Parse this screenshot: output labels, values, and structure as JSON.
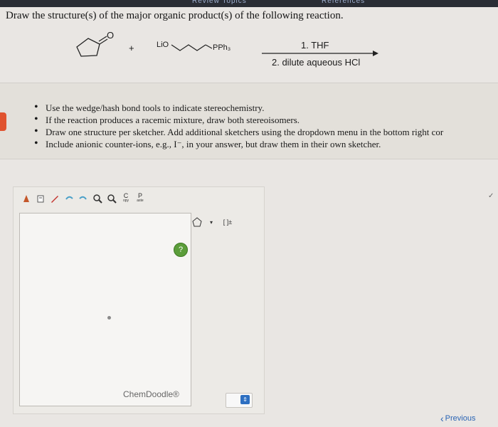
{
  "header": {
    "nav_tab_1": "Review Topics",
    "nav_tab_2": "References"
  },
  "question": "Draw the structure(s) of the major organic product(s) of the following reaction.",
  "reaction": {
    "plus": "+",
    "reagent_left": "LiO",
    "reagent_right": "PPh₃",
    "conditions_1": "1. THF",
    "conditions_2": "2. dilute aqueous HCl",
    "ketone_oxygen": "O"
  },
  "instructions": [
    "Use the wedge/hash bond tools to indicate stereochemistry.",
    "If the reaction produces a racemic mixture, draw both stereoisomers.",
    "Draw one structure per sketcher. Add additional sketchers using the dropdown menu in the bottom right cor",
    "Include anionic counter-ions, e.g., I⁻, in your answer, but draw them in their own sketcher."
  ],
  "sketcher": {
    "copy_label": "C",
    "copy_sub": "opy",
    "paste_label": "P",
    "paste_sub": "aste",
    "help": "?",
    "branding": "ChemDoodle®",
    "template_label": "[ ]±"
  },
  "footer": {
    "previous": "Previous"
  },
  "colors": {
    "accent_tab": "#e0532f",
    "help_green": "#5b9d3a",
    "link_blue": "#2a64b4",
    "dropdown_blue": "#2d6fc1"
  }
}
